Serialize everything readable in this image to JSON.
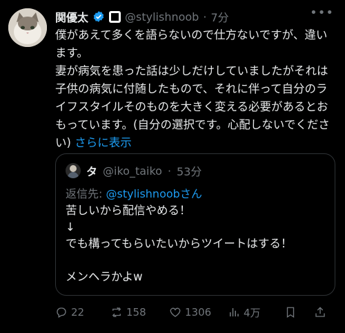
{
  "tweet": {
    "display_name": "関優太",
    "handle": "@stylishnoob",
    "separator": "·",
    "time": "7分",
    "text": "僕があえて多くを語らないので仕方ないですが、違います。\n妻が病気を患った話は少しだけしていましたがそれは子供の病気に付随したもので、それに伴って自分のライフスタイルそのものを大きく変える必要があるとおもっています。(自分の選択です。心配しないでください)",
    "show_more": "さらに表示"
  },
  "quote": {
    "display_name": "タ",
    "handle": "@iko_taiko",
    "separator": "·",
    "time": "53分",
    "replying_prefix": "返信先: ",
    "replying_mention": "@stylishnoob",
    "replying_suffix": "さん",
    "text": "苦しいから配信やめる！\n↓\nでも構ってもらいたいからツイートはする！\n\nメンヘラかよw"
  },
  "actions": {
    "replies": "22",
    "reposts": "158",
    "likes": "1306",
    "views": "4万"
  },
  "colors": {
    "background": "#000000",
    "text": "#e7e9ea",
    "muted": "#71767b",
    "accent": "#1d9bf0",
    "border": "#2f3336"
  }
}
